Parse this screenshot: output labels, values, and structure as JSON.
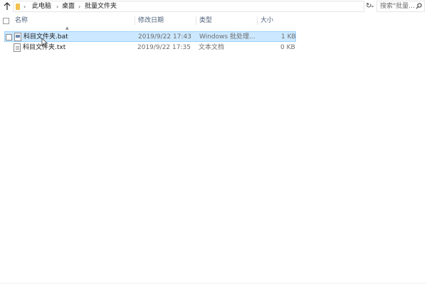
{
  "address_bar": {
    "breadcrumbs": [
      "此电脑",
      "桌面",
      "批量文件夹"
    ],
    "separator": "›",
    "dropdown_glyph": "⌄",
    "refresh_glyph": "↻"
  },
  "search": {
    "placeholder": "搜索\"批量...",
    "icon": "search-icon"
  },
  "columns": {
    "name": "名称",
    "modified": "修改日期",
    "type": "类型",
    "size": "大小"
  },
  "files": [
    {
      "name": "科目文件夹.bat",
      "modified": "2019/9/22 17:43",
      "type": "Windows 批处理...",
      "size": "1 KB",
      "icon": "batch-file-icon",
      "state": "selected"
    },
    {
      "name": "科目文件夹.txt",
      "modified": "2019/9/22 17:35",
      "type": "文本文档",
      "size": "0 KB",
      "icon": "text-file-icon",
      "state": "normal"
    }
  ],
  "colors": {
    "selection_bg": "#cce8ff",
    "selection_border": "#99d1ff",
    "header_text": "#4c607a",
    "folder": "#f2c14e"
  }
}
